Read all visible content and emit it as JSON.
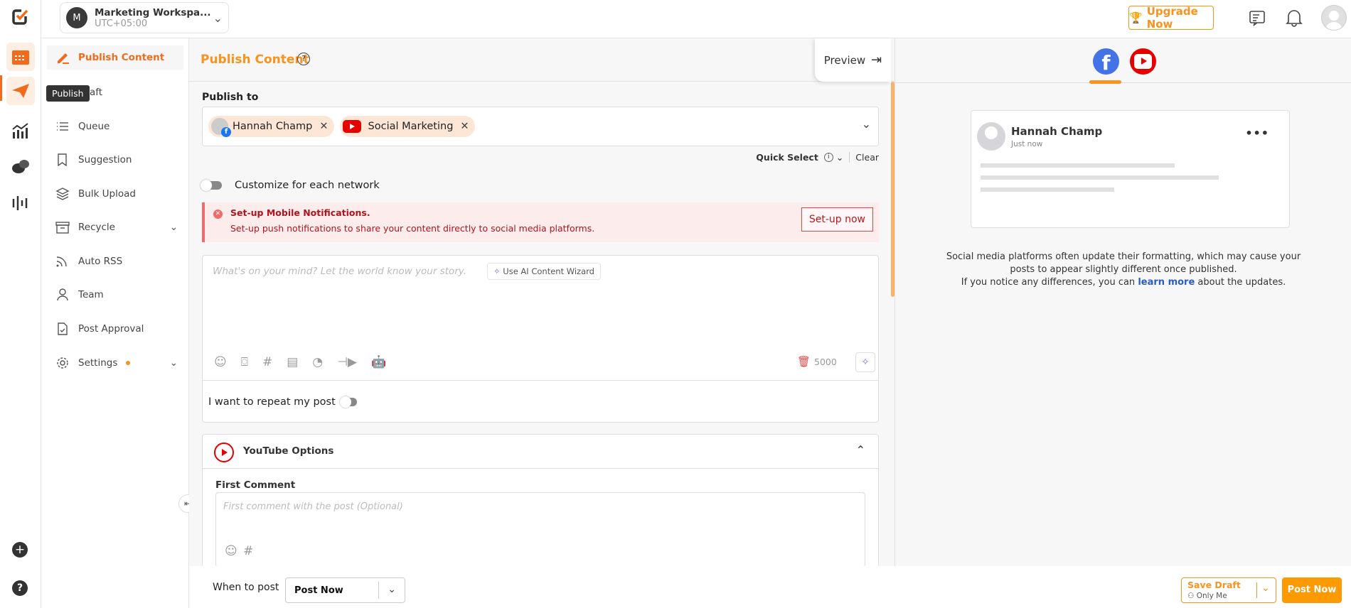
{
  "header": {
    "workspace_initial": "M",
    "workspace_name": "Marketing Workspa...",
    "timezone": "UTC+05:00",
    "upgrade_label": "Upgrade Now"
  },
  "rail": {
    "tooltip": "Publish",
    "items": [
      "calendar",
      "publish",
      "analytics",
      "inbox",
      "listening"
    ]
  },
  "sidebar": {
    "items": [
      {
        "label": "Publish Content",
        "active": true
      },
      {
        "label": "Draft"
      },
      {
        "label": "Queue"
      },
      {
        "label": "Suggestion"
      },
      {
        "label": "Bulk Upload"
      },
      {
        "label": "Recycle"
      },
      {
        "label": "Auto RSS"
      },
      {
        "label": "Team"
      },
      {
        "label": "Post Approval"
      },
      {
        "label": "Settings"
      }
    ]
  },
  "main": {
    "title": "Publish Content",
    "preview_label": "Preview",
    "publish_to_label": "Publish to",
    "accounts": [
      {
        "name": "Hannah Champ",
        "network": "facebook"
      },
      {
        "name": "Social Marketing",
        "network": "youtube"
      }
    ],
    "quick_select": "Quick Select",
    "clear": "Clear",
    "customize_label": "Customize for each network",
    "alert": {
      "title": "Set-up Mobile Notifications.",
      "body": "Set-up push notifications to share your content directly to social media platforms.",
      "button": "Set-up now"
    },
    "editor": {
      "placeholder": "What's on your mind? Let the world know your story.",
      "ai_wizard": "Use AI Content Wizard",
      "char_count": "5000"
    },
    "repeat_label": "I want to repeat my post",
    "youtube": {
      "title": "YouTube Options",
      "first_comment_label": "First Comment",
      "first_comment_placeholder": "First comment with the post (Optional)"
    }
  },
  "preview": {
    "name": "Hannah Champ",
    "time": "Just now",
    "note_1": "Social media platforms often update their formatting, which may cause your",
    "note_2": "posts to appear slightly different once published.",
    "note_3a": "If you notice any differences, you can",
    "note_link": "learn more",
    "note_3b": "about the updates."
  },
  "footer": {
    "when_label": "When to post",
    "when_value": "Post Now",
    "save_draft": "Save Draft",
    "visibility": "Only Me",
    "post_now": "Post Now"
  },
  "colors": {
    "accent": "#f7931e",
    "facebook": "#4473e8",
    "youtube": "#e60000",
    "alert_bg": "#fdecec",
    "alert_text": "#b0141e"
  }
}
